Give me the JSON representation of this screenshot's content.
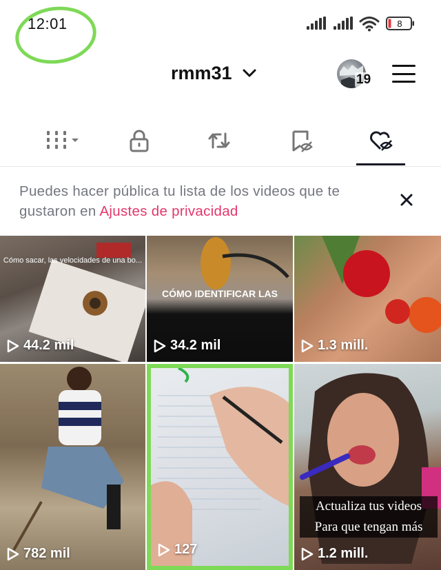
{
  "status_bar": {
    "time": "12:01",
    "battery_level": "8",
    "colors": {
      "annotation_circle": "#7ed957"
    },
    "icons": [
      "cellular-signal-icon",
      "cellular-signal-icon",
      "wifi-icon",
      "battery-icon"
    ]
  },
  "header": {
    "username": "rmm31",
    "avatar_badge_count": "19",
    "icons": [
      "chevron-down-icon",
      "menu-icon"
    ]
  },
  "tabs": [
    {
      "id": "videos",
      "icon": "grid-icon",
      "active": false
    },
    {
      "id": "private",
      "icon": "lock-icon",
      "active": false
    },
    {
      "id": "reposts",
      "icon": "repost-icon",
      "active": false
    },
    {
      "id": "favorites",
      "icon": "bookmark-eye-off-icon",
      "active": false
    },
    {
      "id": "liked",
      "icon": "heart-eye-off-icon",
      "active": true
    }
  ],
  "notice": {
    "text": "Puedes hacer pública tu lista de los videos que te gustaron en ",
    "link": "Ajustes de privacidad"
  },
  "videos": [
    {
      "views": "44.2 mil",
      "caption": "Cómo sacar, las velocidades de una bo..."
    },
    {
      "views": "34.2 mil",
      "caption": "CÓMO IDENTIFICAR LAS"
    },
    {
      "views": "1.3 mill.",
      "caption": ""
    },
    {
      "views": "782 mil",
      "caption": ""
    },
    {
      "views": "127",
      "caption": ""
    },
    {
      "views": "1.2 mill.",
      "caption_line1": "Actualiza tus videos",
      "caption_line2": "Para que tengan más"
    }
  ],
  "colors": {
    "accent_link": "#e5366a",
    "highlight_border": "#7ed957",
    "text_primary": "#161823",
    "text_secondary": "#747680"
  }
}
